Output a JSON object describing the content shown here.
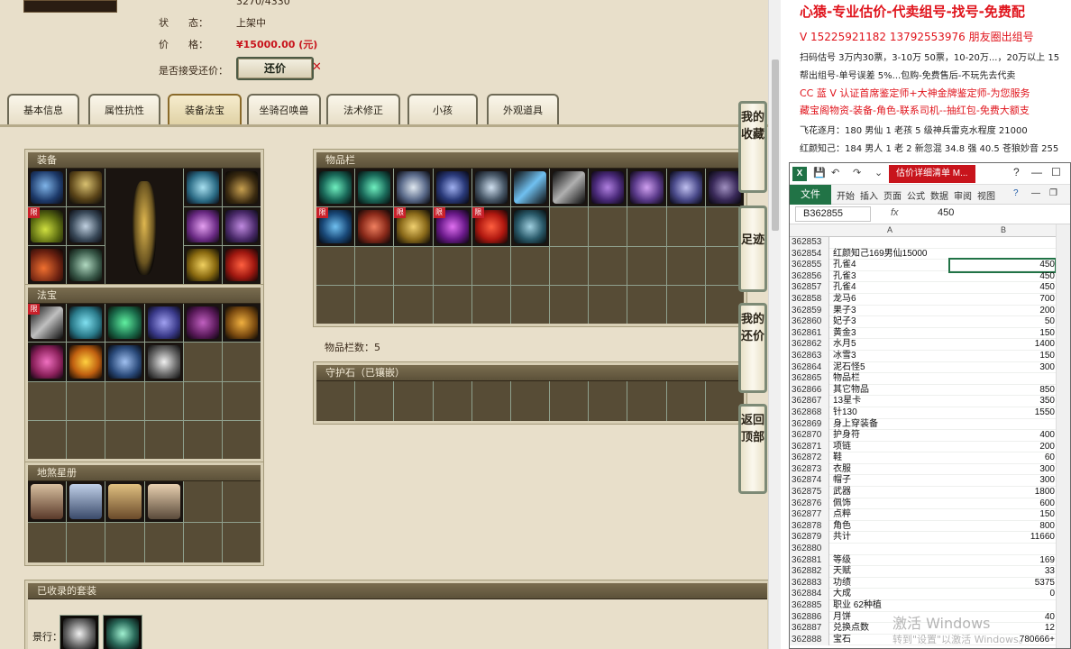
{
  "item_info": {
    "top_value": "3270/4330",
    "status_label": "状　　态：",
    "status_value": "上架中",
    "price_label": "价　　格：",
    "price_value": "¥15000.00 (元)",
    "counter_label": "是否接受还价：",
    "counter_button": "还价",
    "counter_close": "✕"
  },
  "tabs": [
    {
      "label": "基本信息"
    },
    {
      "label": "属性抗性"
    },
    {
      "label": "装备法宝"
    },
    {
      "label": "坐骑召唤兽"
    },
    {
      "label": "法术修正"
    },
    {
      "label": "小孩"
    },
    {
      "label": "外观道具"
    }
  ],
  "panels": {
    "equipment": "装备",
    "fabao": "法宝",
    "dishaxingce": "地煞星册",
    "inventory": "物品栏",
    "guardian": "守护石（已镶嵌）",
    "sets": "已收录的套装"
  },
  "inventory_count": "物品栏数：5",
  "limit_badge": "限",
  "set_row_label": "景行：",
  "side_nav": [
    {
      "label": "我的收藏"
    },
    {
      "label": "足迹"
    },
    {
      "label": "我的还价"
    },
    {
      "label": "返回顶部"
    }
  ],
  "ad": {
    "title": "心猿-专业估价-代卖组号-找号-免费配",
    "lines": [
      "V 15225921182   13792553976 朋友圈出组号",
      "扫码估号 3万内30票，3-10万 50票，10-20万...，20万以上 15",
      "帮出组号-单号误差 5%...包购-免费售后-不玩先去代卖",
      "CC 蓝 V 认证首席鉴定师+大神金牌鉴定师-为您服务",
      "藏宝阁物资-装备-角色-联系司机--抽红包-免费大额支",
      "飞花逐月：180 男仙 1 老孩 5 级神兵雷克水程度 21000",
      "红颜知己：184 男人 1 老 2 新忽混 34.8 强 40.5 苍狼妙音 255"
    ]
  },
  "excel": {
    "title": "估价详细清单 M...",
    "file_tab": "文件",
    "ribbon_tabs": [
      "开始",
      "插入",
      "页面",
      "公式",
      "数据",
      "审阅",
      "视图"
    ],
    "name_box": "B362855",
    "fx": "fx",
    "formula_value": "450",
    "col_a": "A",
    "col_b": "B",
    "rows": [
      {
        "n": "362853",
        "a": "",
        "b": ""
      },
      {
        "n": "362854",
        "a": "红颜知己169男仙15000",
        "b": ""
      },
      {
        "n": "362855",
        "a": "孔雀4",
        "b": "450"
      },
      {
        "n": "362856",
        "a": "孔雀3",
        "b": "450"
      },
      {
        "n": "362857",
        "a": "孔雀4",
        "b": "450"
      },
      {
        "n": "362858",
        "a": "龙马6",
        "b": "700"
      },
      {
        "n": "362859",
        "a": "果子3",
        "b": "200"
      },
      {
        "n": "362860",
        "a": "妃子3",
        "b": "50"
      },
      {
        "n": "362861",
        "a": "黄金3",
        "b": "150"
      },
      {
        "n": "362862",
        "a": "水月5",
        "b": "1400"
      },
      {
        "n": "362863",
        "a": "冰雪3",
        "b": "150"
      },
      {
        "n": "362864",
        "a": "泥石怪5",
        "b": "300"
      },
      {
        "n": "362865",
        "a": "物品栏",
        "b": ""
      },
      {
        "n": "362866",
        "a": "其它物品",
        "b": "850"
      },
      {
        "n": "362867",
        "a": "13星卡",
        "b": "350"
      },
      {
        "n": "362868",
        "a": "针130",
        "b": "1550"
      },
      {
        "n": "362869",
        "a": "身上穿装备",
        "b": ""
      },
      {
        "n": "362870",
        "a": "护身符",
        "b": "400"
      },
      {
        "n": "362871",
        "a": "项链",
        "b": "200"
      },
      {
        "n": "362872",
        "a": "鞋",
        "b": "60"
      },
      {
        "n": "362873",
        "a": "衣服",
        "b": "300"
      },
      {
        "n": "362874",
        "a": "帽子",
        "b": "300"
      },
      {
        "n": "362875",
        "a": "武器",
        "b": "1800"
      },
      {
        "n": "362876",
        "a": "佩饰",
        "b": "600"
      },
      {
        "n": "362877",
        "a": "点粹",
        "b": "150"
      },
      {
        "n": "362878",
        "a": "角色",
        "b": "800"
      },
      {
        "n": "362879",
        "a": "共计",
        "b": "11660"
      },
      {
        "n": "362880",
        "a": "",
        "b": ""
      },
      {
        "n": "362881",
        "a": "等级",
        "b": "169"
      },
      {
        "n": "362882",
        "a": "天赋",
        "b": "33"
      },
      {
        "n": "362883",
        "a": "功绩",
        "b": "5375"
      },
      {
        "n": "362884",
        "a": "大成",
        "b": "0"
      },
      {
        "n": "362885",
        "a": "职业                     62种植",
        "b": ""
      },
      {
        "n": "362886",
        "a": "月饼",
        "b": "40"
      },
      {
        "n": "362887",
        "a": "兑换点数",
        "b": "12"
      },
      {
        "n": "362888",
        "a": "宝石",
        "b": "780666+"
      }
    ]
  },
  "watermark": {
    "line1": "激活 Windows",
    "line2": "转到\"设置\"以激活 Windows。"
  },
  "colors": {
    "panel_bg": "#4f4530",
    "grid_line": "#8fa08d",
    "price_red": "#c8141c",
    "excel_green": "#217346"
  }
}
